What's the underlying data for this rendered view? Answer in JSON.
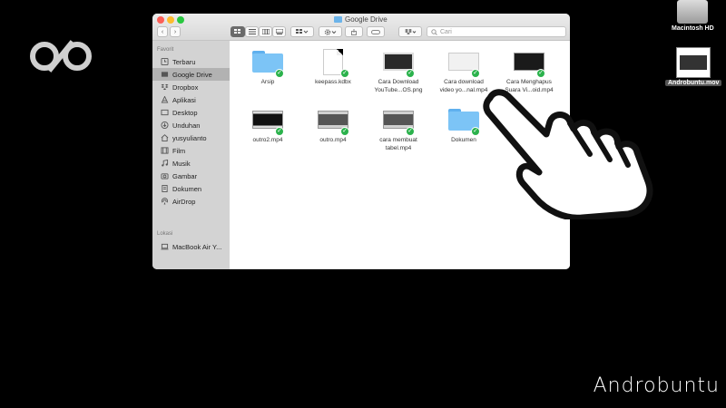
{
  "window": {
    "title": "Google Drive"
  },
  "toolbar": {
    "back": "‹",
    "forward": "›",
    "search_placeholder": "Cari"
  },
  "sidebar": {
    "favorites_header": "Favorit",
    "favorites": [
      {
        "label": "Terbaru",
        "icon": "clock-icon"
      },
      {
        "label": "Google Drive",
        "icon": "drive-folder-icon",
        "selected": true
      },
      {
        "label": "Dropbox",
        "icon": "dropbox-icon"
      },
      {
        "label": "Aplikasi",
        "icon": "apps-icon"
      },
      {
        "label": "Desktop",
        "icon": "desktop-icon"
      },
      {
        "label": "Unduhan",
        "icon": "download-icon"
      },
      {
        "label": "yusyulianto",
        "icon": "home-icon"
      },
      {
        "label": "Film",
        "icon": "film-icon"
      },
      {
        "label": "Musik",
        "icon": "music-icon"
      },
      {
        "label": "Gambar",
        "icon": "camera-icon"
      },
      {
        "label": "Dokumen",
        "icon": "document-icon"
      },
      {
        "label": "AirDrop",
        "icon": "airdrop-icon"
      }
    ],
    "locations_header": "Lokasi",
    "locations": [
      {
        "label": "MacBook Air Y...",
        "icon": "laptop-icon"
      }
    ]
  },
  "files": [
    {
      "name": "Arsip",
      "kind": "folder"
    },
    {
      "name": "keepass.kdbx",
      "kind": "document"
    },
    {
      "name": "Cara Download\nYouTube...OS.png",
      "kind": "image"
    },
    {
      "name": "Cara download\nvideo yo...nal.mp4",
      "kind": "video"
    },
    {
      "name": "Cara Menghapus\nSuara Vi...oid.mp4",
      "kind": "video"
    },
    {
      "name": "outro2.mp4",
      "kind": "video"
    },
    {
      "name": "outro.mp4",
      "kind": "video"
    },
    {
      "name": "cara membuat\ntabel.mp4",
      "kind": "video"
    },
    {
      "name": "Dokumen",
      "kind": "folder"
    }
  ],
  "desktop": {
    "hdd_label": "Macintosh HD",
    "mov_label": "Androbuntu.mov"
  },
  "watermark": "Androbuntu"
}
